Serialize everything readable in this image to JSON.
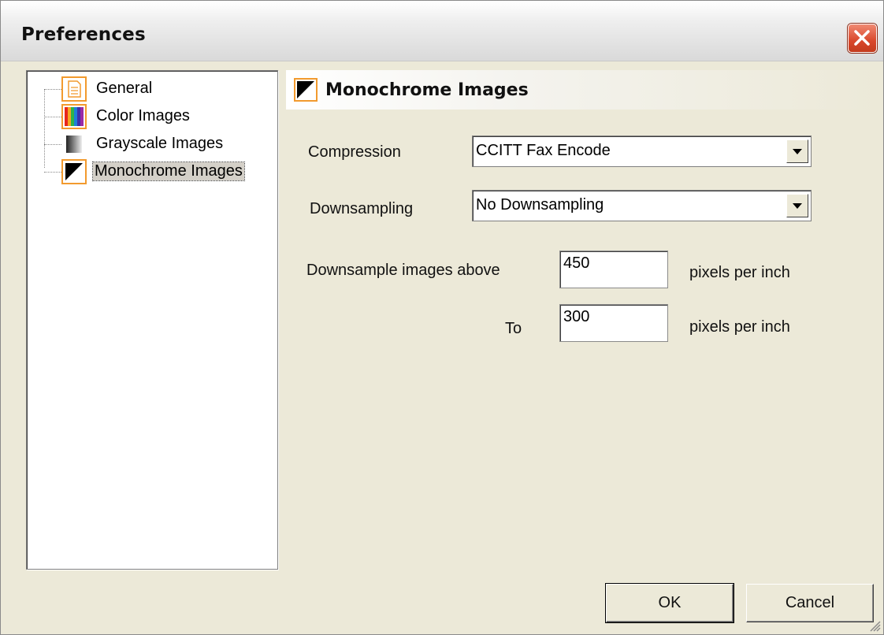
{
  "window": {
    "title": "Preferences"
  },
  "tree": {
    "items": [
      {
        "label": "General",
        "icon": "general-page-icon"
      },
      {
        "label": "Color Images",
        "icon": "color-images-icon"
      },
      {
        "label": "Grayscale Images",
        "icon": "grayscale-images-icon"
      },
      {
        "label": "Monochrome Images",
        "icon": "monochrome-images-icon",
        "selected": true
      }
    ]
  },
  "panel": {
    "title": "Monochrome Images",
    "compression": {
      "label": "Compression",
      "value": "CCITT Fax Encode"
    },
    "downsampling": {
      "label": "Downsampling",
      "value": "No Downsampling"
    },
    "downsample_above": {
      "label": "Downsample images above",
      "value": "450",
      "unit": "pixels per inch"
    },
    "downsample_to": {
      "label": "To",
      "value": "300",
      "unit": "pixels per inch"
    }
  },
  "buttons": {
    "ok": "OK",
    "cancel": "Cancel"
  },
  "colors": {
    "icon_border": "#f29a2e",
    "dialog_bg": "#ece9d8",
    "close_red": "#d9472b"
  }
}
